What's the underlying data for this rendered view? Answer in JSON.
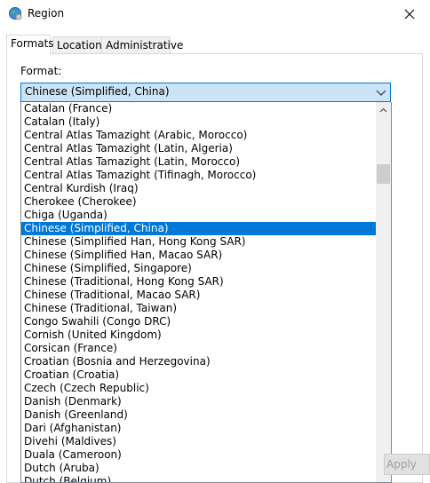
{
  "window": {
    "title": "Region",
    "icon": "region-globe-icon"
  },
  "tabs": [
    {
      "label": "Formats",
      "active": true
    },
    {
      "label": "Location",
      "active": false
    },
    {
      "label": "Administrative",
      "active": false
    }
  ],
  "format": {
    "label": "Format:",
    "selected": "Chinese (Simplified, China)"
  },
  "dropdown": {
    "items": [
      "Catalan (France)",
      "Catalan (Italy)",
      "Central Atlas Tamazight (Arabic, Morocco)",
      "Central Atlas Tamazight (Latin, Algeria)",
      "Central Atlas Tamazight (Latin, Morocco)",
      "Central Atlas Tamazight (Tifinagh, Morocco)",
      "Central Kurdish (Iraq)",
      "Cherokee (Cherokee)",
      "Chiga (Uganda)",
      "Chinese (Simplified, China)",
      "Chinese (Simplified Han, Hong Kong SAR)",
      "Chinese (Simplified Han, Macao SAR)",
      "Chinese (Simplified, Singapore)",
      "Chinese (Traditional, Hong Kong SAR)",
      "Chinese (Traditional, Macao SAR)",
      "Chinese (Traditional, Taiwan)",
      "Congo Swahili (Congo DRC)",
      "Cornish (United Kingdom)",
      "Corsican (France)",
      "Croatian (Bosnia and Herzegovina)",
      "Croatian (Croatia)",
      "Czech (Czech Republic)",
      "Danish (Denmark)",
      "Danish (Greenland)",
      "Dari (Afghanistan)",
      "Divehi (Maldives)",
      "Duala (Cameroon)",
      "Dutch (Aruba)",
      "Dutch (Belgium)"
    ],
    "selected_index": 9
  },
  "buttons": {
    "apply": "Apply"
  },
  "colors": {
    "selection": "#0078d7",
    "combo_bg": "#cce4f7"
  }
}
